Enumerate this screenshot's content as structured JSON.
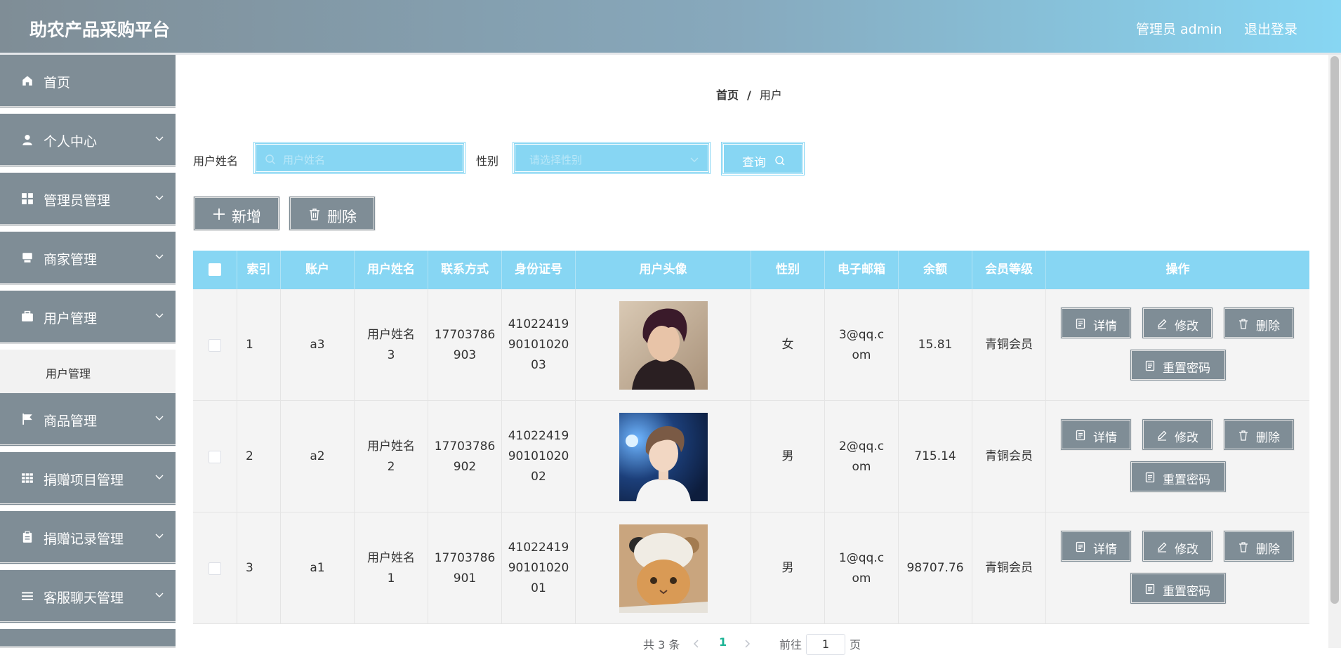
{
  "header": {
    "title": "助农产品采购平台",
    "user": "管理员 admin",
    "logout": "退出登录"
  },
  "sidebar": {
    "items": [
      {
        "label": "首页",
        "icon": "home-icon"
      },
      {
        "label": "个人中心",
        "icon": "user-icon"
      },
      {
        "label": "管理员管理",
        "icon": "grid-icon"
      },
      {
        "label": "商家管理",
        "icon": "shop-icon"
      },
      {
        "label": "用户管理",
        "icon": "briefcase-icon"
      },
      {
        "label": "商品管理",
        "icon": "flag-icon"
      },
      {
        "label": "捐赠项目管理",
        "icon": "apps-icon"
      },
      {
        "label": "捐赠记录管理",
        "icon": "clipboard-icon"
      },
      {
        "label": "客服聊天管理",
        "icon": "list-icon"
      }
    ],
    "subitem": "用户管理"
  },
  "breadcrumb": {
    "home": "首页",
    "separator": "/",
    "current": "用户"
  },
  "search": {
    "name_label": "用户姓名",
    "name_placeholder": "用户姓名",
    "gender_label": "性别",
    "gender_placeholder": "请选择性别",
    "button": "查询"
  },
  "actions": {
    "add": "新增",
    "delete": "删除"
  },
  "table": {
    "headers": [
      "索引",
      "账户",
      "用户姓名",
      "联系方式",
      "身份证号",
      "用户头像",
      "性别",
      "电子邮箱",
      "余额",
      "会员等级",
      "操作"
    ],
    "rows": [
      {
        "index": "1",
        "account": "a3",
        "name": "用户姓名3",
        "phone": "17703786903",
        "id_no": "410224199010102003",
        "gender": "女",
        "email": "3@qq.com",
        "balance": "15.81",
        "level": "青铜会员"
      },
      {
        "index": "2",
        "account": "a2",
        "name": "用户姓名2",
        "phone": "17703786902",
        "id_no": "410224199010102002",
        "gender": "男",
        "email": "2@qq.com",
        "balance": "715.14",
        "level": "青铜会员"
      },
      {
        "index": "3",
        "account": "a1",
        "name": "用户姓名1",
        "phone": "17703786901",
        "id_no": "410224199010102001",
        "gender": "男",
        "email": "1@qq.com",
        "balance": "98707.76",
        "level": "青铜会员"
      }
    ],
    "ops": {
      "detail": "详情",
      "edit": "修改",
      "delete": "删除",
      "reset": "重置密码"
    }
  },
  "pagination": {
    "total": "共 3 条",
    "current": "1",
    "goto": "前往",
    "page_value": "1",
    "page_unit": "页"
  },
  "colors": {
    "accent": "#87d6f3",
    "menu": "#7f8d96",
    "active_page": "#1ab394"
  }
}
